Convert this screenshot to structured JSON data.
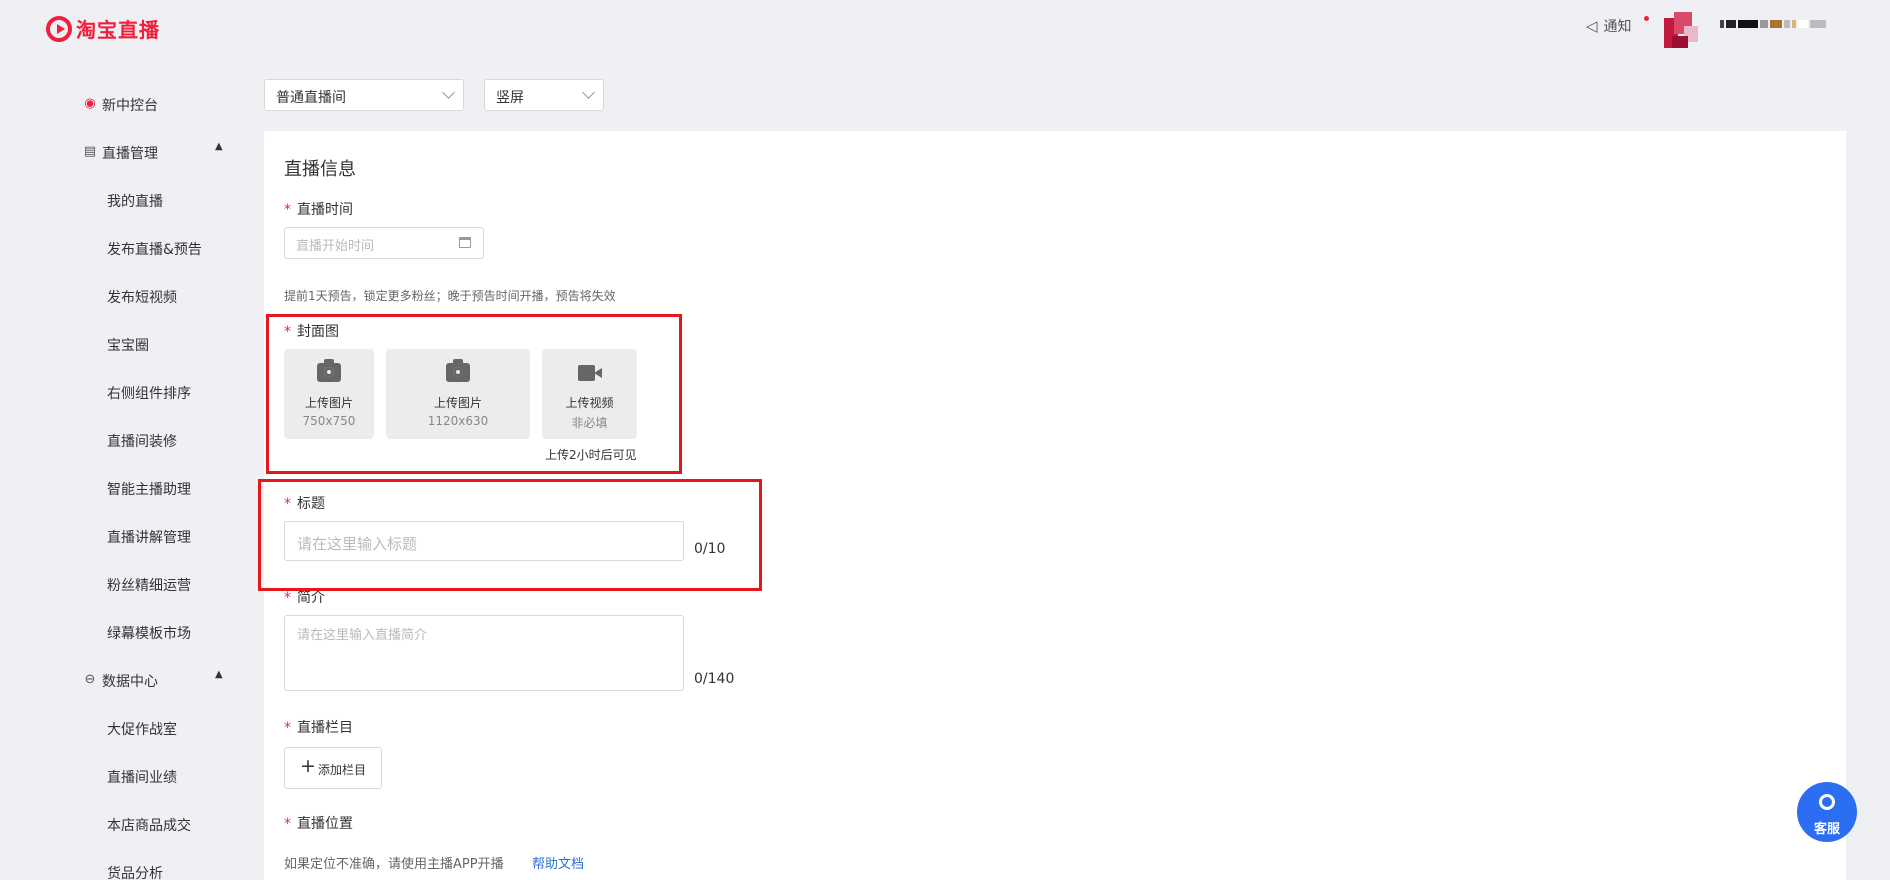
{
  "brand": {
    "name": "淘宝直播"
  },
  "header": {
    "notify_label": "通知",
    "user_name_masked": true
  },
  "sidebar": {
    "items": [
      {
        "type": "top",
        "label": "新中控台",
        "icon": "live-logo-icon"
      },
      {
        "type": "group",
        "label": "直播管理",
        "icon": "document-icon",
        "expanded": true
      },
      {
        "type": "sub",
        "label": "我的直播"
      },
      {
        "type": "sub",
        "label": "发布直播&预告"
      },
      {
        "type": "sub",
        "label": "发布短视频"
      },
      {
        "type": "sub",
        "label": "宝宝圈"
      },
      {
        "type": "sub",
        "label": "右侧组件排序"
      },
      {
        "type": "sub",
        "label": "直播间装修"
      },
      {
        "type": "sub",
        "label": "智能主播助理"
      },
      {
        "type": "sub",
        "label": "直播讲解管理"
      },
      {
        "type": "sub",
        "label": "粉丝精细运营"
      },
      {
        "type": "sub",
        "label": "绿幕模板市场"
      },
      {
        "type": "group",
        "label": "数据中心",
        "icon": "data-center-icon",
        "expanded": true
      },
      {
        "type": "sub",
        "label": "大促作战室"
      },
      {
        "type": "sub",
        "label": "直播间业绩"
      },
      {
        "type": "sub",
        "label": "本店商品成交"
      },
      {
        "type": "sub",
        "label": "货品分析"
      }
    ]
  },
  "filters": {
    "room_type": "普通直播间",
    "orientation": "竖屏"
  },
  "form": {
    "title": "直播信息",
    "time": {
      "label": "直播时间",
      "placeholder": "直播开始时间",
      "hint": "提前1天预告，锁定更多粉丝；晚于预告时间开播，预告将失效"
    },
    "cover": {
      "label": "封面图",
      "tiles": [
        {
          "title": "上传图片",
          "sub": "750x750",
          "icon": "camera-icon"
        },
        {
          "title": "上传图片",
          "sub": "1120x630",
          "icon": "camera-icon"
        },
        {
          "title": "上传视频",
          "sub": "非必填",
          "icon": "video-camera-icon"
        }
      ],
      "video_note": "上传2小时后可见"
    },
    "headline": {
      "label": "标题",
      "placeholder": "请在这里输入标题",
      "counter": "0/10"
    },
    "intro": {
      "label": "简介",
      "placeholder": "请在这里输入直播简介",
      "counter": "0/140"
    },
    "column": {
      "label": "直播栏目",
      "add_button": "添加栏目"
    },
    "location": {
      "label": "直播位置",
      "hint": "如果定位不准确，请使用主播APP开播",
      "help_link": "帮助文档"
    },
    "required_mark": "*"
  },
  "service_button": {
    "label": "客服"
  },
  "colors": {
    "brand_red": "#f0203c",
    "highlight_red": "#e4181c",
    "link_blue": "#2f6fd9",
    "service_blue": "#2b6ef2"
  }
}
